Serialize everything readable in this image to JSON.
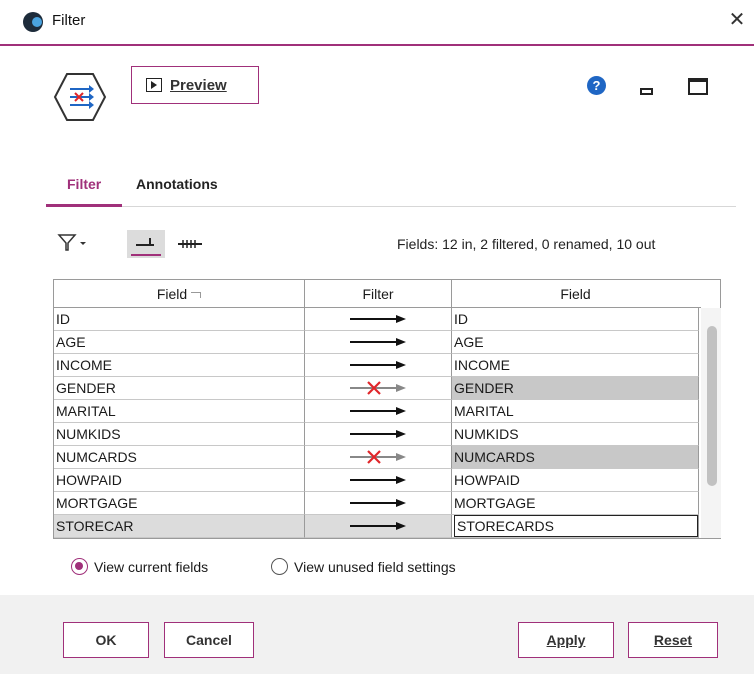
{
  "window": {
    "title": "Filter",
    "close_glyph": "✕"
  },
  "toolbar": {
    "preview_label": "Preview",
    "help_glyph": "?"
  },
  "tabs": [
    {
      "label": "Filter",
      "active": true
    },
    {
      "label": "Annotations",
      "active": false
    }
  ],
  "field_toolbar": {
    "filter_icon": "funnel-dropdown-icon",
    "selected_toggle_icon": "show-filtered-icon",
    "all_toggle_icon": "show-all-icon",
    "status": "Fields: 12 in, 2 filtered, 0 renamed, 10 out"
  },
  "table": {
    "headers": [
      "Field",
      "Filter",
      "Field"
    ],
    "rows": [
      {
        "field": "ID",
        "filtered": false,
        "out": "ID"
      },
      {
        "field": "AGE",
        "filtered": false,
        "out": "AGE"
      },
      {
        "field": "INCOME",
        "filtered": false,
        "out": "INCOME"
      },
      {
        "field": "GENDER",
        "filtered": true,
        "out": "GENDER"
      },
      {
        "field": "MARITAL",
        "filtered": false,
        "out": "MARITAL"
      },
      {
        "field": "NUMKIDS",
        "filtered": false,
        "out": "NUMKIDS"
      },
      {
        "field": "NUMCARDS",
        "filtered": true,
        "out": "NUMCARDS"
      },
      {
        "field": "HOWPAID",
        "filtered": false,
        "out": "HOWPAID"
      },
      {
        "field": "MORTGAGE",
        "filtered": false,
        "out": "MORTGAGE"
      },
      {
        "field": "STORECAR",
        "filtered": false,
        "out": "STORECARDS",
        "selected": true,
        "editing": true
      }
    ]
  },
  "view_options": {
    "current_label": "View current fields",
    "unused_label": "View unused field settings",
    "selected": "current"
  },
  "footer": {
    "ok": "OK",
    "cancel": "Cancel",
    "apply": "Apply",
    "reset": "Reset"
  },
  "colors": {
    "accent": "#a0307a",
    "filtered_cell": "#c8c8c8",
    "filter_x": "#e0262a",
    "help": "#1f66c4"
  }
}
